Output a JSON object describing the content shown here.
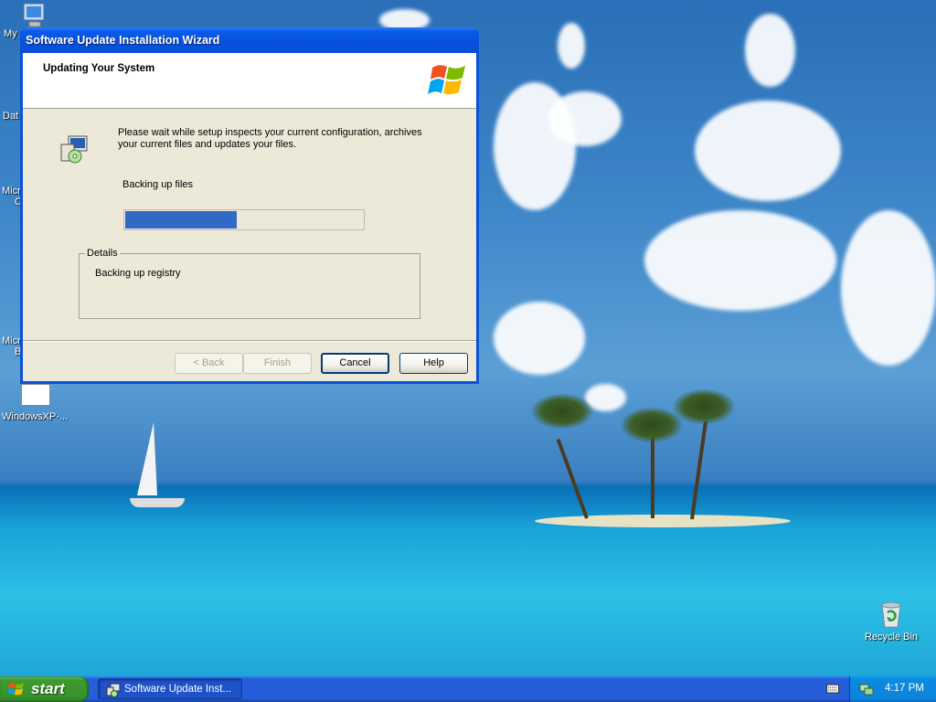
{
  "desktop": {
    "icons": [
      {
        "label": "My",
        "name": "desktop-icon-my-computer"
      },
      {
        "label": "Dat",
        "name": "desktop-icon-data"
      },
      {
        "label": "Micro",
        "label2": "C",
        "name": "desktop-icon-microsoft-1"
      },
      {
        "label": "Micro",
        "label2": "B",
        "name": "desktop-icon-microsoft-2"
      },
      {
        "label": "WindowsXP-...",
        "name": "desktop-icon-windowsxp-file"
      },
      {
        "label": "Recycle Bin",
        "name": "desktop-icon-recycle-bin"
      }
    ]
  },
  "wizard": {
    "title": "Software Update Installation Wizard",
    "header_title": "Updating Your System",
    "intro_text": "Please wait while setup inspects your current configuration, archives your current files and updates your files.",
    "progress_label": "Backing up files",
    "progress_fraction": 0.47,
    "details_legend": "Details",
    "details_text": "Backing up registry",
    "buttons": {
      "back": "< Back",
      "finish": "Finish",
      "cancel": "Cancel",
      "help": "Help"
    }
  },
  "taskbar": {
    "start_label": "start",
    "task_label": "Software Update Inst...",
    "clock": "4:17 PM"
  },
  "colors": {
    "titlebar": "#0551dd",
    "progress": "#316ac5",
    "taskbar": "#245edb",
    "start": "#3c9a2e",
    "tray": "#0c84da"
  }
}
